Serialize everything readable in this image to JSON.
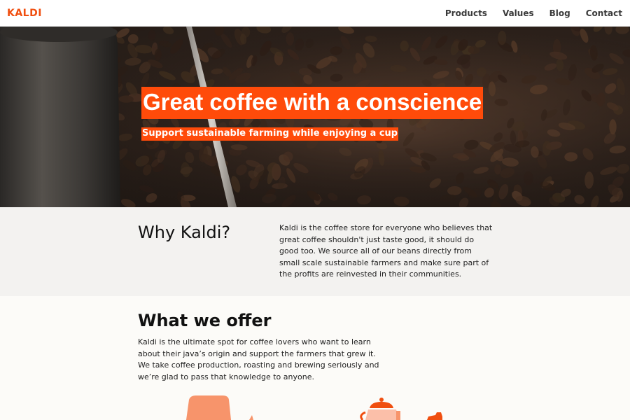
{
  "header": {
    "logo": "KALDI",
    "nav": [
      {
        "label": "Products"
      },
      {
        "label": "Values"
      },
      {
        "label": "Blog"
      },
      {
        "label": "Contact"
      }
    ]
  },
  "hero": {
    "title": "Great coffee with a conscience",
    "subtitle": "Support sustainable farming while enjoying a cup"
  },
  "why": {
    "title": "Why Kaldi?",
    "text": "Kaldi is the coffee store for everyone who believes that great coffee shouldn't just taste good, it should do good too. We source all of our beans directly from small scale sustainable farmers and make sure part of the profits are reinvested in their communities."
  },
  "offer": {
    "title": "What we offer",
    "text": "Kaldi is the ultimate spot for coffee lovers who want to learn about their java’s origin and support the farmers that grew it. We take coffee production, roasting and brewing seriously and we’re glad to pass that knowledge to anyone."
  },
  "colors": {
    "brand": "#f04e0f",
    "accent": "#ff4b0a",
    "illustration_light": "#fbbfa9",
    "illustration_mid": "#f7946b"
  },
  "icons": {
    "hero_image": "coffee-beans-photo",
    "illustration_left": "coffee-bag-icon",
    "illustration_right": "coffee-kettle-icon"
  }
}
